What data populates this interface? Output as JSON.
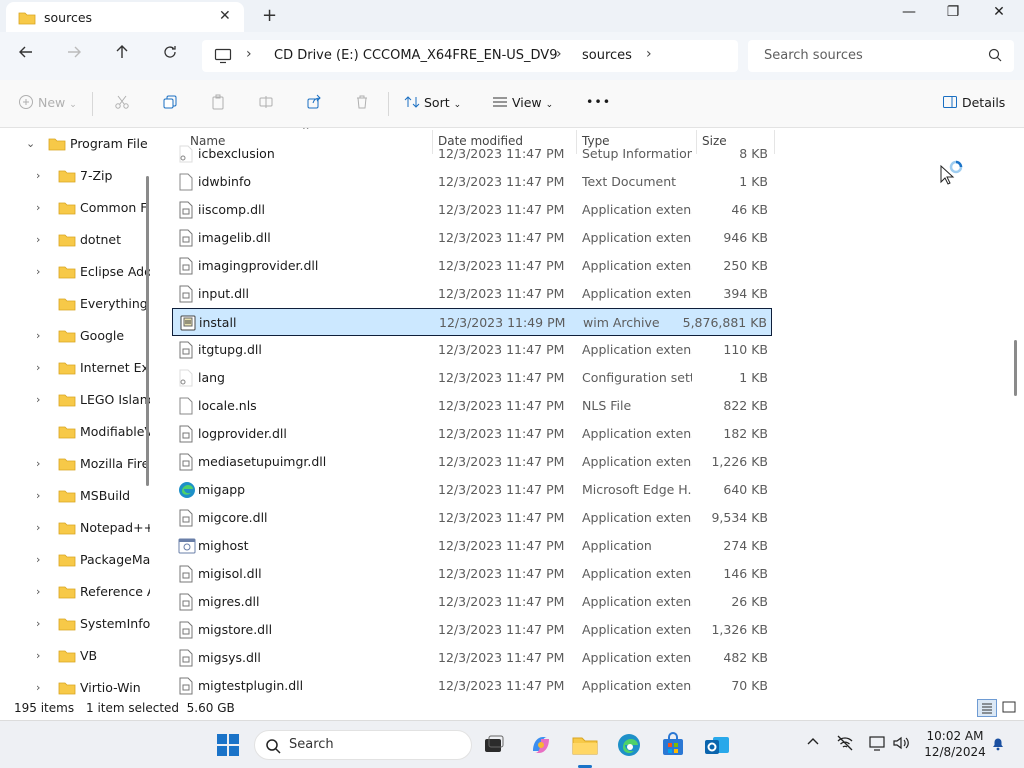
{
  "window": {
    "tab_title": "sources",
    "minimize_glyph": "—",
    "maximize_glyph": "❐",
    "close_glyph": "✕"
  },
  "nav": {
    "breadcrumb": [
      "CD Drive (E:) CCCOMA_X64FRE_EN-US_DV9",
      "sources"
    ],
    "search_placeholder": "Search sources"
  },
  "commands": {
    "new": "New",
    "sort": "Sort",
    "view": "View",
    "more": "•••",
    "details": "Details"
  },
  "sidebar": {
    "items": [
      {
        "label": "Program File",
        "expanded": true,
        "level": 0
      },
      {
        "label": "7-Zip",
        "expandable": true
      },
      {
        "label": "Common F",
        "expandable": true
      },
      {
        "label": "dotnet",
        "expandable": true
      },
      {
        "label": "Eclipse Ado",
        "expandable": true
      },
      {
        "label": "Everything",
        "expandable": false
      },
      {
        "label": "Google",
        "expandable": true
      },
      {
        "label": "Internet Exp",
        "expandable": true
      },
      {
        "label": "LEGO Island",
        "expandable": true
      },
      {
        "label": "ModifiableV",
        "expandable": false
      },
      {
        "label": "Mozilla Fire",
        "expandable": true
      },
      {
        "label": "MSBuild",
        "expandable": true
      },
      {
        "label": "Notepad++",
        "expandable": true
      },
      {
        "label": "PackageMa",
        "expandable": true
      },
      {
        "label": "Reference A",
        "expandable": true
      },
      {
        "label": "SystemInfo",
        "expandable": true
      },
      {
        "label": "VB",
        "expandable": true
      },
      {
        "label": "Virtio-Win",
        "expandable": true
      }
    ]
  },
  "columns": {
    "name": "Name",
    "date": "Date modified",
    "type": "Type",
    "size": "Size"
  },
  "files": [
    {
      "name": "icbexclusion",
      "date": "12/3/2023 11:47 PM",
      "type": "Setup Information",
      "size": "8 KB",
      "icon": "settings-file-icon"
    },
    {
      "name": "idwbinfo",
      "date": "12/3/2023 11:47 PM",
      "type": "Text Document",
      "size": "1 KB",
      "icon": "blank-file-icon"
    },
    {
      "name": "iiscomp.dll",
      "date": "12/3/2023 11:47 PM",
      "type": "Application extens...",
      "size": "46 KB",
      "icon": "dll-file-icon"
    },
    {
      "name": "imagelib.dll",
      "date": "12/3/2023 11:47 PM",
      "type": "Application extens...",
      "size": "946 KB",
      "icon": "dll-file-icon"
    },
    {
      "name": "imagingprovider.dll",
      "date": "12/3/2023 11:47 PM",
      "type": "Application extens...",
      "size": "250 KB",
      "icon": "dll-file-icon"
    },
    {
      "name": "input.dll",
      "date": "12/3/2023 11:47 PM",
      "type": "Application extens...",
      "size": "394 KB",
      "icon": "dll-file-icon"
    },
    {
      "name": "install",
      "date": "12/3/2023 11:49 PM",
      "type": "wim Archive",
      "size": "5,876,881 KB",
      "icon": "wim-archive-icon",
      "selected": true
    },
    {
      "name": "itgtupg.dll",
      "date": "12/3/2023 11:47 PM",
      "type": "Application extens...",
      "size": "110 KB",
      "icon": "dll-file-icon"
    },
    {
      "name": "lang",
      "date": "12/3/2023 11:47 PM",
      "type": "Configuration sett...",
      "size": "1 KB",
      "icon": "settings-file-icon"
    },
    {
      "name": "locale.nls",
      "date": "12/3/2023 11:47 PM",
      "type": "NLS File",
      "size": "822 KB",
      "icon": "blank-file-icon"
    },
    {
      "name": "logprovider.dll",
      "date": "12/3/2023 11:47 PM",
      "type": "Application extens...",
      "size": "182 KB",
      "icon": "dll-file-icon"
    },
    {
      "name": "mediasetupuimgr.dll",
      "date": "12/3/2023 11:47 PM",
      "type": "Application extens...",
      "size": "1,226 KB",
      "icon": "dll-file-icon"
    },
    {
      "name": "migapp",
      "date": "12/3/2023 11:47 PM",
      "type": "Microsoft Edge H...",
      "size": "640 KB",
      "icon": "edge-html-icon"
    },
    {
      "name": "migcore.dll",
      "date": "12/3/2023 11:47 PM",
      "type": "Application extens...",
      "size": "9,534 KB",
      "icon": "dll-file-icon"
    },
    {
      "name": "mighost",
      "date": "12/3/2023 11:47 PM",
      "type": "Application",
      "size": "274 KB",
      "icon": "application-icon"
    },
    {
      "name": "migisol.dll",
      "date": "12/3/2023 11:47 PM",
      "type": "Application extens...",
      "size": "146 KB",
      "icon": "dll-file-icon"
    },
    {
      "name": "migres.dll",
      "date": "12/3/2023 11:47 PM",
      "type": "Application extens...",
      "size": "26 KB",
      "icon": "dll-file-icon"
    },
    {
      "name": "migstore.dll",
      "date": "12/3/2023 11:47 PM",
      "type": "Application extens...",
      "size": "1,326 KB",
      "icon": "dll-file-icon"
    },
    {
      "name": "migsys.dll",
      "date": "12/3/2023 11:47 PM",
      "type": "Application extens...",
      "size": "482 KB",
      "icon": "dll-file-icon"
    },
    {
      "name": "migtestplugin.dll",
      "date": "12/3/2023 11:47 PM",
      "type": "Application extens...",
      "size": "70 KB",
      "icon": "dll-file-icon"
    }
  ],
  "status": {
    "item_count": "195 items",
    "selection": "1 item selected  5.60 GB"
  },
  "taskbar": {
    "search_placeholder": "Search",
    "time": "10:02 AM",
    "date": "12/8/2024"
  },
  "colors": {
    "accent": "#0067c0",
    "selection": "#cce8ff",
    "folder": "#f7c948"
  }
}
